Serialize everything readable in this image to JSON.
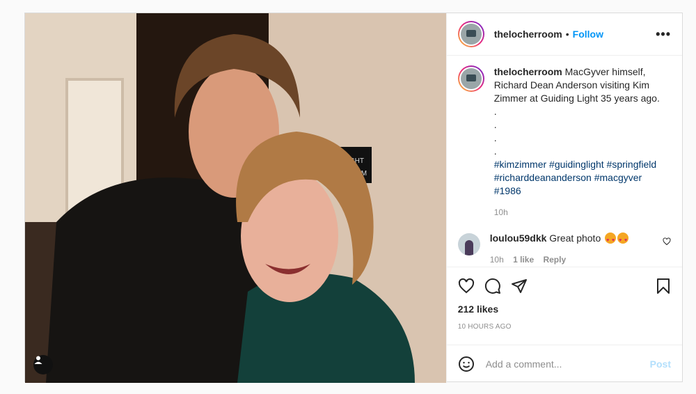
{
  "photo": {
    "sign_text_1": "G LIGHT",
    "sign_text_2": "ROOM"
  },
  "header": {
    "username": "thelocherroom",
    "separator": "•",
    "follow_label": "Follow",
    "more_label": "•••"
  },
  "caption": {
    "username": "thelocherroom",
    "text": "MacGyver himself, Richard Dean Anderson visiting Kim Zimmer at Guiding Light 35 years ago.",
    "dots": [
      ".",
      ".",
      ".",
      "."
    ],
    "hashtags": "#kimzimmer #guidinglight #springfield #richarddeananderson #macgyver #1986",
    "time": "10h"
  },
  "comment": {
    "username": "loulou59dkk",
    "text": "Great photo",
    "time": "10h",
    "likes": "1 like",
    "reply": "Reply"
  },
  "likes": "212 likes",
  "posted": "10 HOURS AGO",
  "add_comment": {
    "placeholder": "Add a comment...",
    "post_label": "Post"
  },
  "icons": [
    "heart-icon",
    "comment-icon",
    "share-icon",
    "bookmark-icon",
    "emoji-icon",
    "user-tag-icon",
    "more-icon"
  ]
}
